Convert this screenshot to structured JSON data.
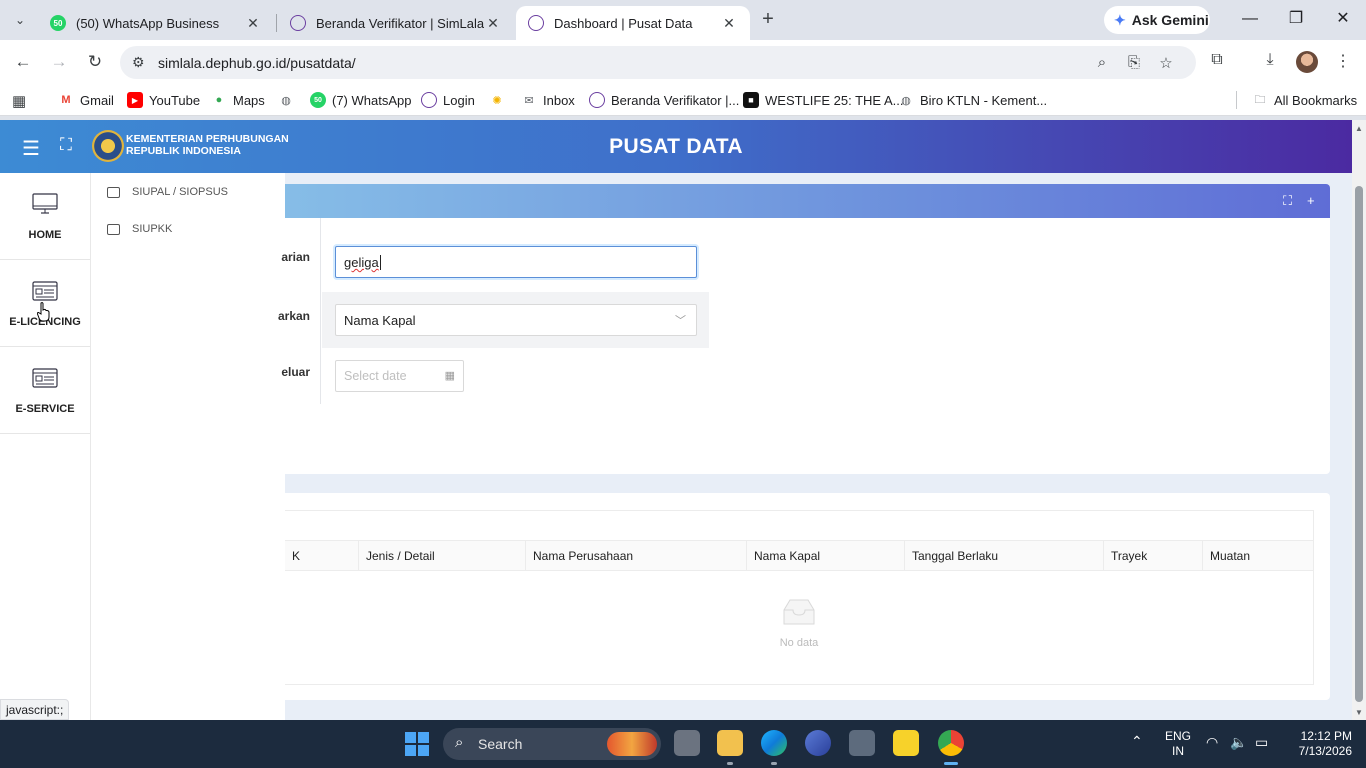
{
  "browser": {
    "tabs": [
      {
        "title": "(50) WhatsApp Business",
        "favicon_text": "50"
      },
      {
        "title": "Beranda Verifikator | SimLala"
      },
      {
        "title": "Dashboard | Pusat Data"
      }
    ],
    "ask_gemini": "Ask Gemini",
    "url": "simlala.dephub.go.id/pusatdata/",
    "bookmarks": [
      "Gmail",
      "YouTube",
      "Maps",
      "(7) WhatsApp",
      "Login",
      "Inbox",
      "Beranda Verifikator |...",
      "WESTLIFE 25: THE A...",
      "Biro KTLN - Kement..."
    ],
    "whatsapp_badge": "50",
    "all_bookmarks": "All Bookmarks",
    "status_url": "javascript:;"
  },
  "header": {
    "org_line1": "KEMENTERIAN PERHUBUNGAN",
    "org_line2": "REPUBLIK INDONESIA",
    "title": "PUSAT DATA"
  },
  "rail": {
    "items": [
      {
        "label": "HOME",
        "icon": "monitor-icon"
      },
      {
        "label": "E-LICENCING",
        "icon": "id-card-icon"
      },
      {
        "label": "E-SERVICE",
        "icon": "id-card-icon"
      }
    ]
  },
  "submenu": {
    "items": [
      "SIUPAL / SIOPSUS",
      "SIUPKK"
    ]
  },
  "form": {
    "label_search": "arian",
    "label_by": "arkan",
    "label_issued": "eluar",
    "search_value": "geliga",
    "select_value": "Nama Kapal",
    "date_placeholder": "Select date"
  },
  "table": {
    "columns": [
      "K",
      "Jenis / Detail",
      "Nama Perusahaan",
      "Nama Kapal",
      "Tanggal Berlaku",
      "Trayek",
      "Muatan"
    ],
    "empty_text": "No data"
  },
  "taskbar": {
    "search_placeholder": "Search",
    "lang_line1": "ENG",
    "lang_line2": "IN",
    "time": "12:12 PM",
    "date": "7/13/2026"
  },
  "colors": {
    "header_gradient_start": "#3d8bd4",
    "header_gradient_end": "#4b2aa1",
    "input_focus": "#5b8fd8"
  }
}
